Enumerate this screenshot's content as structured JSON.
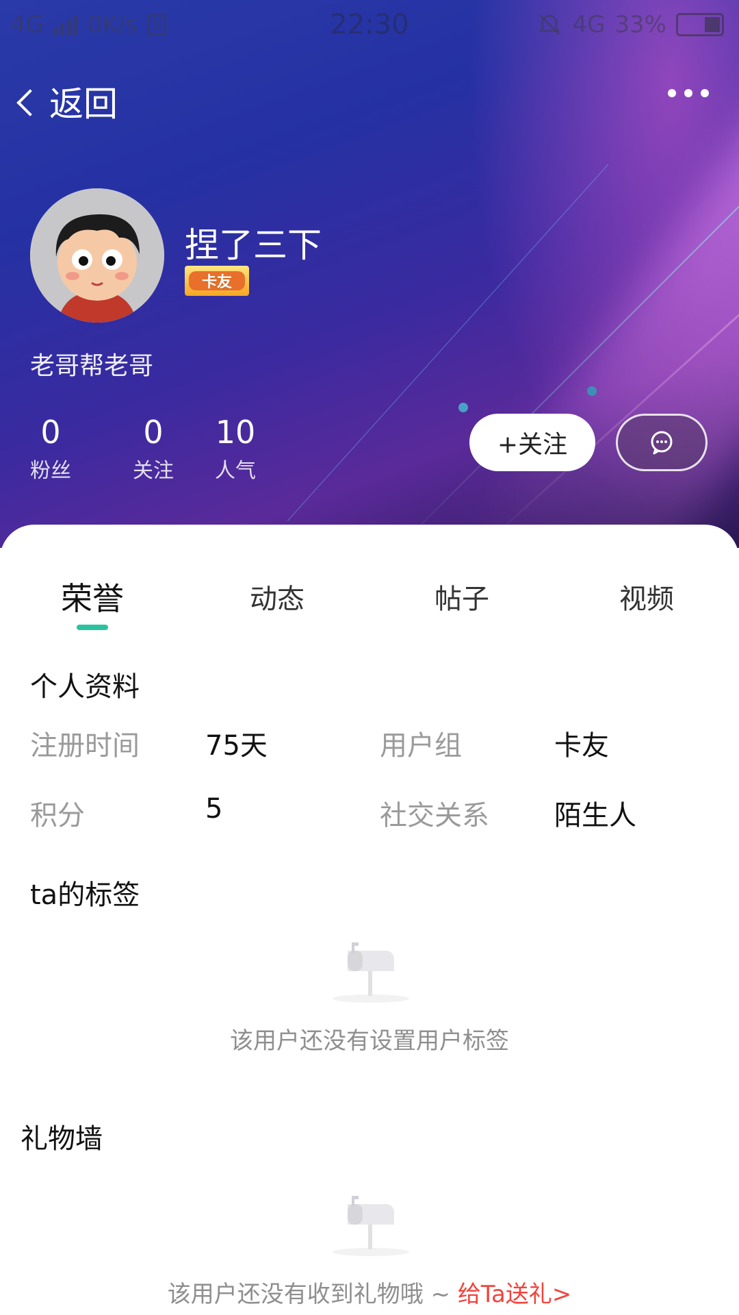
{
  "status_bar": {
    "network_left": "4G",
    "speed": "0K/s",
    "time": "22:30",
    "network_right": "4G",
    "battery": "33%"
  },
  "nav": {
    "back_label": "返回",
    "more_icon": "more-dots-icon"
  },
  "profile": {
    "username": "捏了三下",
    "badge": "卡友",
    "bio": "老哥帮老哥",
    "stats": [
      {
        "value": "0",
        "label": "粉丝"
      },
      {
        "value": "0",
        "label": "关注"
      },
      {
        "value": "10",
        "label": "人气"
      }
    ],
    "follow_label": "+关注",
    "message_icon": "chat-bubble-icon"
  },
  "tabs": [
    "荣誉",
    "动态",
    "帖子",
    "视频"
  ],
  "active_tab": 0,
  "personal_info": {
    "title": "个人资料",
    "rows": [
      {
        "label1": "注册时间",
        "value1": "75天",
        "label2": "用户组",
        "value2": "卡友"
      },
      {
        "label1": "积分",
        "value1": "5",
        "label2": "社交关系",
        "value2": "陌生人"
      }
    ]
  },
  "tags": {
    "title": "ta的标签",
    "empty_text": "该用户还没有设置用户标签"
  },
  "gifts": {
    "title": "礼物墙",
    "empty_text": "该用户还没有收到礼物哦 ~ ",
    "send_link": "给Ta送礼>"
  },
  "colors": {
    "accent": "#2cc2a0",
    "link_red": "#f2433b"
  }
}
